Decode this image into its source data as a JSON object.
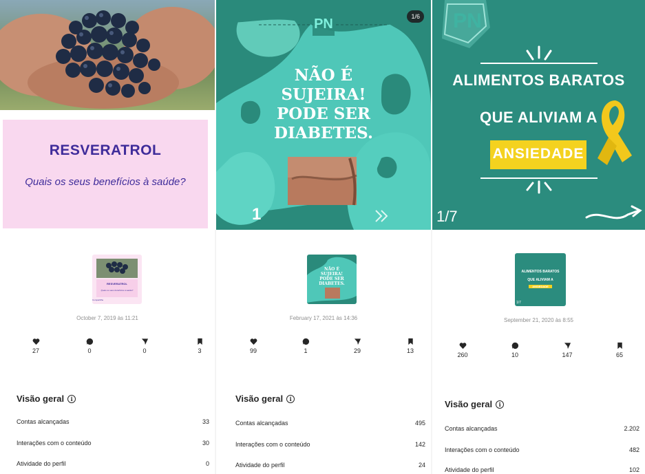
{
  "posts": [
    {
      "poster": {
        "title": "RESVERATROL",
        "subtitle": "Quais os seus benefícios à saúde?",
        "thumb_caption": "Compartilhe"
      },
      "date": "October 7, 2019 às 11:21",
      "stats": {
        "likes": "27",
        "comments": "0",
        "shares": "0",
        "saves": "3"
      },
      "overview": {
        "title": "Visão geral",
        "rows": [
          {
            "label": "Contas alcançadas",
            "value": "33"
          },
          {
            "label": "Interações com o conteúdo",
            "value": "30"
          },
          {
            "label": "Atividade do perfil",
            "value": "0"
          }
        ]
      }
    },
    {
      "poster": {
        "logo": "PN",
        "page_badge": "1/6",
        "headline": [
          "NÃO É",
          "SUJEIRA!",
          "PODE SER",
          "DIABETES."
        ],
        "page_number": "1"
      },
      "date": "February 17, 2021 às 14:36",
      "stats": {
        "likes": "99",
        "comments": "1",
        "shares": "29",
        "saves": "13"
      },
      "overview": {
        "title": "Visão geral",
        "rows": [
          {
            "label": "Contas alcançadas",
            "value": "495"
          },
          {
            "label": "Interações com o conteúdo",
            "value": "142"
          },
          {
            "label": "Atividade do perfil",
            "value": "24"
          }
        ]
      }
    },
    {
      "poster": {
        "logo": "PN",
        "line1": "ALIMENTOS BARATOS",
        "line2": "QUE ALIVIAM A",
        "highlight": "ANSIEDADE",
        "page_indicator": "1/7"
      },
      "date": "September 21, 2020 às 8:55",
      "stats": {
        "likes": "260",
        "comments": "10",
        "shares": "147",
        "saves": "65"
      },
      "overview": {
        "title": "Visão geral",
        "rows": [
          {
            "label": "Contas alcançadas",
            "value": "2.202"
          },
          {
            "label": "Interações com o conteúdo",
            "value": "482"
          },
          {
            "label": "Atividade do perfil",
            "value": "102"
          }
        ]
      }
    }
  ],
  "icons": {
    "likes": "heart-icon",
    "comments": "comment-icon",
    "shares": "share-icon",
    "saves": "bookmark-icon"
  },
  "colors": {
    "teal": "#2a8a7b",
    "pink": "#f9d8ef",
    "purple": "#3f2c9a",
    "yellow": "#f4d21f"
  }
}
